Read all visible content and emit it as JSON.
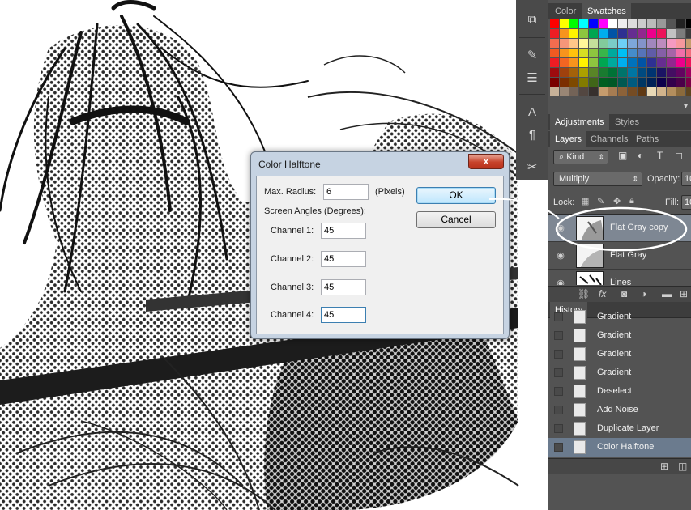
{
  "colors": {
    "panel_bg": "#535353",
    "tab_bg": "#3d3d3d",
    "history_selected": "#6b7b8e",
    "dialog_frame": "#c6d3e2",
    "close_red": "#c7432b"
  },
  "tools": {
    "icons": [
      "3d-cube-icon",
      "brush-options-icon",
      "adjust-sliders-icon",
      "character-icon",
      "paragraph-icon",
      "tools-settings-icon"
    ]
  },
  "swatches_panel": {
    "tabs": [
      "Color",
      "Swatches"
    ],
    "active_tab": "Swatches",
    "palette": [
      [
        "#ff0000",
        "#ffff00",
        "#00ff00",
        "#00ffff",
        "#0000ff",
        "#ff00ff",
        "#ffffff",
        "#eeeeee",
        "#dddddd",
        "#cccccc",
        "#bbbbbb",
        "#999999",
        "#555555",
        "#222222",
        "#000000"
      ],
      [
        "#ee1d24",
        "#f7941d",
        "#fff200",
        "#8dc63f",
        "#00a651",
        "#00aeef",
        "#0054a6",
        "#2e3192",
        "#662d91",
        "#92278f",
        "#ec008c",
        "#ed145b",
        "#c2c2c2",
        "#7c7c7c",
        "#3b3b3b"
      ],
      [
        "#f26c4f",
        "#f69679",
        "#fdc689",
        "#fff799",
        "#c4df9b",
        "#82ca9c",
        "#7accc8",
        "#6dcff6",
        "#7da7d9",
        "#8393ca",
        "#a187be",
        "#bd8cbf",
        "#f49ac1",
        "#f6989d",
        "#c69c6d"
      ],
      [
        "#f15a22",
        "#f7941d",
        "#ffc20e",
        "#d6de23",
        "#8dc63f",
        "#39b54a",
        "#00a99d",
        "#00bff3",
        "#448ccb",
        "#5674b9",
        "#605ca8",
        "#855fa8",
        "#a763a8",
        "#f06ea9",
        "#f26d7d"
      ],
      [
        "#ed1c24",
        "#f26522",
        "#f7941d",
        "#fff200",
        "#8dc63f",
        "#00a651",
        "#00a99d",
        "#00aeef",
        "#0072bc",
        "#0054a6",
        "#2e3192",
        "#662d91",
        "#92278f",
        "#ec008c",
        "#ed145b"
      ],
      [
        "#9e0b0f",
        "#a0410d",
        "#a3620a",
        "#aba000",
        "#598527",
        "#197b30",
        "#007236",
        "#00746b",
        "#0076a3",
        "#004a80",
        "#003471",
        "#1b1464",
        "#440e62",
        "#630460",
        "#9e005d"
      ],
      [
        "#790000",
        "#7b2e00",
        "#7d4900",
        "#827b00",
        "#406618",
        "#005e20",
        "#005826",
        "#005952",
        "#005b7f",
        "#003663",
        "#002157",
        "#0d004c",
        "#32004b",
        "#4b0049",
        "#7b0046"
      ],
      [
        "#c7b299",
        "#998675",
        "#736357",
        "#534741",
        "#37302d",
        "#c69c6d",
        "#a67c52",
        "#8c6239",
        "#754c24",
        "#603913",
        "#e9d9b6",
        "#d2b48c",
        "#b38e5d",
        "#8a6a3c",
        "#5e4520"
      ]
    ]
  },
  "adjustments_panel": {
    "tabs": [
      "Adjustments",
      "Styles"
    ],
    "active_tab": "Adjustments"
  },
  "layers_panel": {
    "tabs": [
      "Layers",
      "Channels",
      "Paths"
    ],
    "active_tab": "Layers",
    "filter_label": "Kind",
    "blend_mode": "Multiply",
    "opacity_label": "Opacity:",
    "opacity_value": "10",
    "lock_label": "Lock:",
    "fill_label": "Fill:",
    "fill_value": "10",
    "layers": [
      {
        "name": "Flat Gray copy",
        "selected": true
      },
      {
        "name": "Flat Gray",
        "selected": false
      },
      {
        "name": "Lines",
        "selected": false
      }
    ]
  },
  "history_panel": {
    "tab": "History",
    "items": [
      {
        "label": "Gradient",
        "selected": false
      },
      {
        "label": "Gradient",
        "selected": false
      },
      {
        "label": "Gradient",
        "selected": false
      },
      {
        "label": "Gradient",
        "selected": false
      },
      {
        "label": "Deselect",
        "selected": false
      },
      {
        "label": "Add Noise",
        "selected": false
      },
      {
        "label": "Duplicate Layer",
        "selected": false
      },
      {
        "label": "Color Halftone",
        "selected": true
      }
    ]
  },
  "dialog": {
    "title": "Color Halftone",
    "close_label": "x",
    "max_radius_label": "Max. Radius:",
    "max_radius_value": "6",
    "max_radius_unit": "(Pixels)",
    "screen_angles_label": "Screen Angles (Degrees):",
    "channels": [
      {
        "label": "Channel 1:",
        "value": "45"
      },
      {
        "label": "Channel 2:",
        "value": "45"
      },
      {
        "label": "Channel 3:",
        "value": "45"
      },
      {
        "label": "Channel 4:",
        "value": "45"
      }
    ],
    "ok_label": "OK",
    "cancel_label": "Cancel"
  }
}
